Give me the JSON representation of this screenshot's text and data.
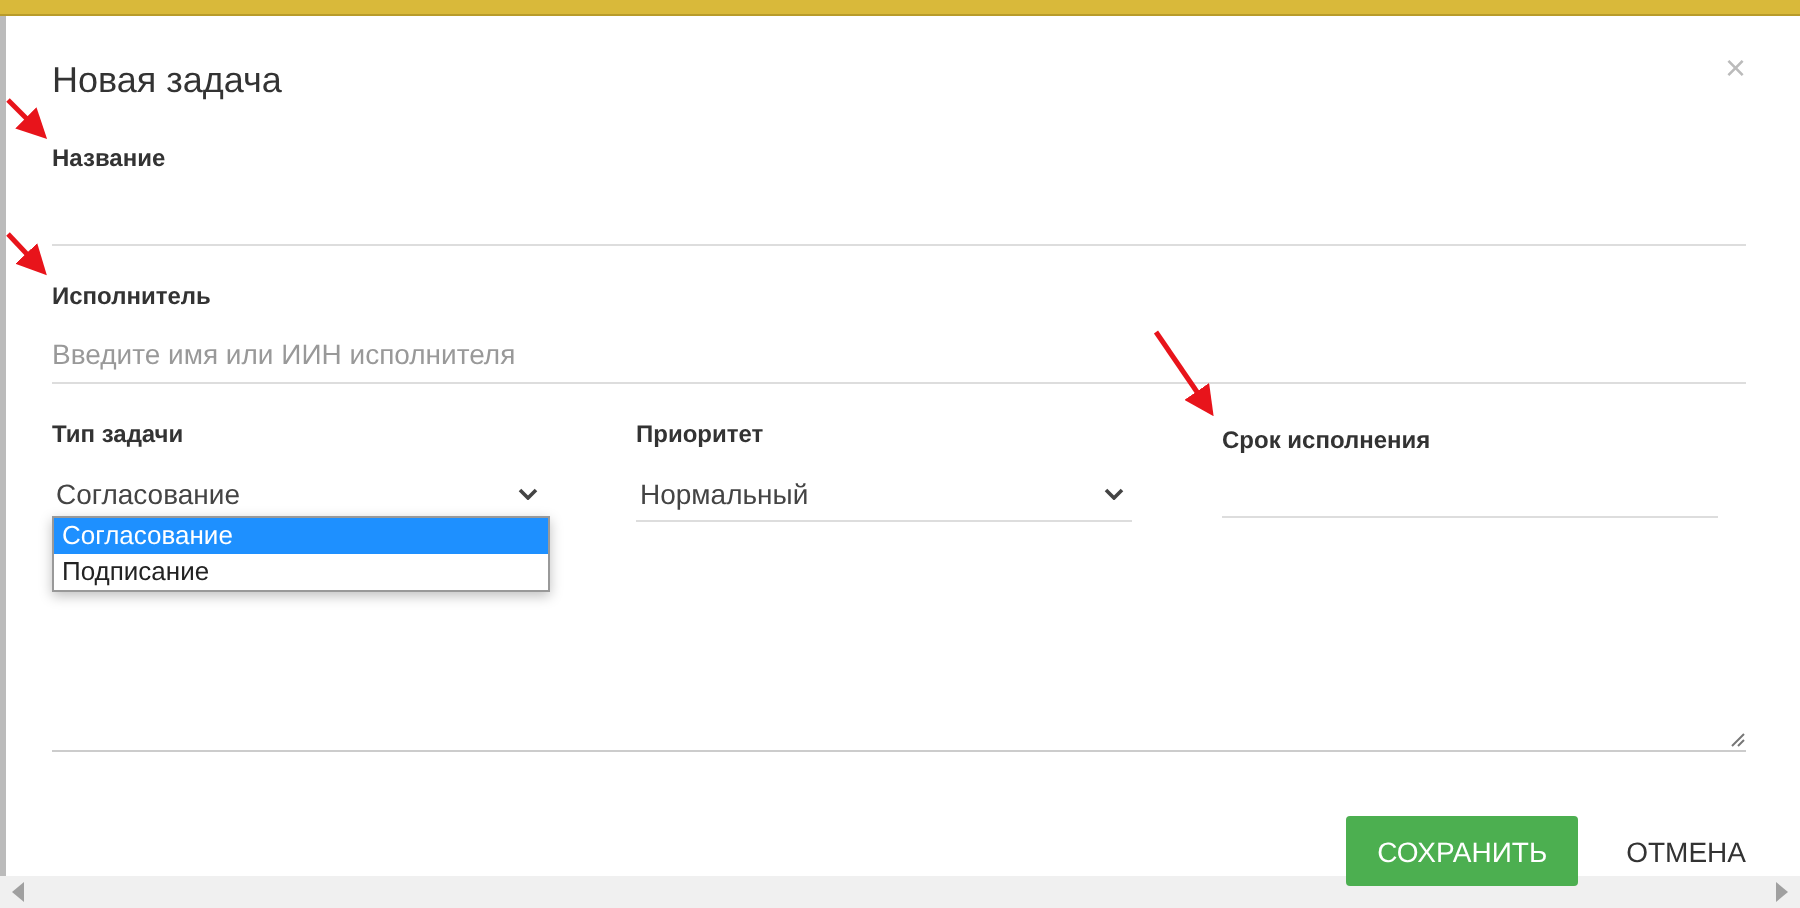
{
  "dialog": {
    "title": "Новая задача",
    "close": "×"
  },
  "fields": [
    {
      "kind": "text",
      "label": "Название"
    },
    {
      "kind": "text",
      "label": "Исполнитель",
      "placeholder": "Введите имя или ИИН исполнителя"
    }
  ],
  "row": [
    {
      "kind": "select",
      "label": "Тип задачи",
      "value": "Согласование",
      "expanded": true,
      "options": [
        {
          "label": "Согласование",
          "selected": true
        },
        {
          "label": "Подписание",
          "selected": false
        }
      ]
    },
    {
      "kind": "select",
      "label": "Приоритет",
      "value": "Нормальный"
    },
    {
      "kind": "date",
      "label": "Срок исполнения"
    }
  ],
  "buttons": [
    {
      "kind": "primary",
      "label": "СОХРАНИТЬ"
    },
    {
      "kind": "flat",
      "label": "ОТМЕНА"
    }
  ]
}
